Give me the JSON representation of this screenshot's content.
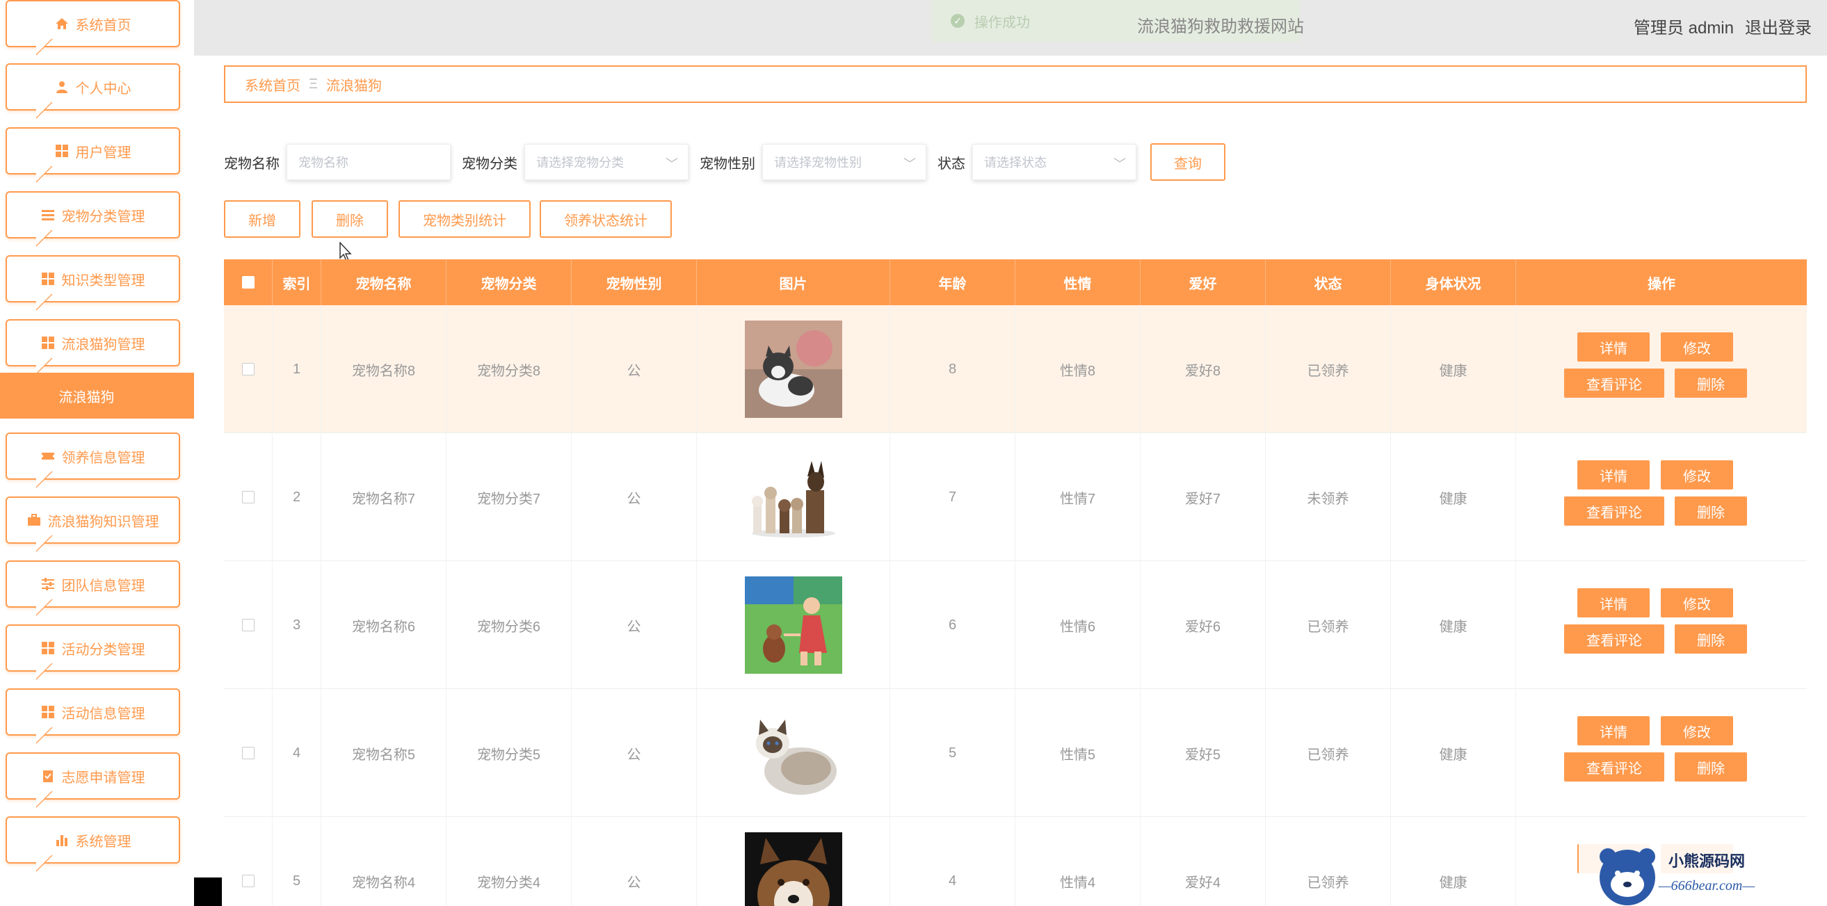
{
  "header": {
    "site_title": "流浪猫狗救助救援网站",
    "admin_label": "管理员 admin",
    "logout": "退出登录",
    "toast": "操作成功"
  },
  "sidebar": {
    "items": [
      {
        "label": "系统首页",
        "icon": "home-icon"
      },
      {
        "label": "个人中心",
        "icon": "user-icon"
      },
      {
        "label": "用户管理",
        "icon": "grid-icon"
      },
      {
        "label": "宠物分类管理",
        "icon": "list-icon"
      },
      {
        "label": "知识类型管理",
        "icon": "grid-icon"
      },
      {
        "label": "流浪猫狗管理",
        "icon": "grid-icon"
      },
      {
        "label": "领养信息管理",
        "icon": "ticket-icon"
      },
      {
        "label": "流浪猫狗知识管理",
        "icon": "briefcase-icon"
      },
      {
        "label": "团队信息管理",
        "icon": "sliders-icon"
      },
      {
        "label": "活动分类管理",
        "icon": "grid-icon"
      },
      {
        "label": "活动信息管理",
        "icon": "grid-icon"
      },
      {
        "label": "志愿申请管理",
        "icon": "clipboard-icon"
      },
      {
        "label": "系统管理",
        "icon": "chart-icon"
      }
    ],
    "active_sub": "流浪猫狗"
  },
  "breadcrumb": {
    "home": "系统首页",
    "sep": "Ξ",
    "current": "流浪猫狗"
  },
  "search": {
    "name_label": "宠物名称",
    "name_placeholder": "宠物名称",
    "category_label": "宠物分类",
    "category_placeholder": "请选择宠物分类",
    "gender_label": "宠物性别",
    "gender_placeholder": "请选择宠物性别",
    "status_label": "状态",
    "status_placeholder": "请选择状态",
    "query_btn": "查询"
  },
  "actions": {
    "add": "新增",
    "delete": "删除",
    "category_stats": "宠物类别统计",
    "adopt_stats": "领养状态统计"
  },
  "table": {
    "headers": [
      "索引",
      "宠物名称",
      "宠物分类",
      "宠物性别",
      "图片",
      "年龄",
      "性情",
      "爱好",
      "状态",
      "身体状况",
      "操作"
    ],
    "op_labels": {
      "detail": "详情",
      "edit": "修改",
      "comments": "查看评论",
      "delete": "删除"
    },
    "rows": [
      {
        "index": "1",
        "name": "宠物名称8",
        "category": "宠物分类8",
        "gender": "公",
        "age": "8",
        "temper": "性情8",
        "hobby": "爱好8",
        "status": "已领养",
        "health": "健康"
      },
      {
        "index": "2",
        "name": "宠物名称7",
        "category": "宠物分类7",
        "gender": "公",
        "age": "7",
        "temper": "性情7",
        "hobby": "爱好7",
        "status": "未领养",
        "health": "健康"
      },
      {
        "index": "3",
        "name": "宠物名称6",
        "category": "宠物分类6",
        "gender": "公",
        "age": "6",
        "temper": "性情6",
        "hobby": "爱好6",
        "status": "已领养",
        "health": "健康"
      },
      {
        "index": "4",
        "name": "宠物名称5",
        "category": "宠物分类5",
        "gender": "公",
        "age": "5",
        "temper": "性情5",
        "hobby": "爱好5",
        "status": "已领养",
        "health": "健康"
      },
      {
        "index": "5",
        "name": "宠物名称4",
        "category": "宠物分类4",
        "gender": "公",
        "age": "4",
        "temper": "性情4",
        "hobby": "爱好4",
        "status": "已领养",
        "health": "健康"
      }
    ]
  },
  "watermark": {
    "name": "小熊源码网",
    "url": "—666bear.com—"
  },
  "colors": {
    "accent": "#ff9a4d"
  }
}
